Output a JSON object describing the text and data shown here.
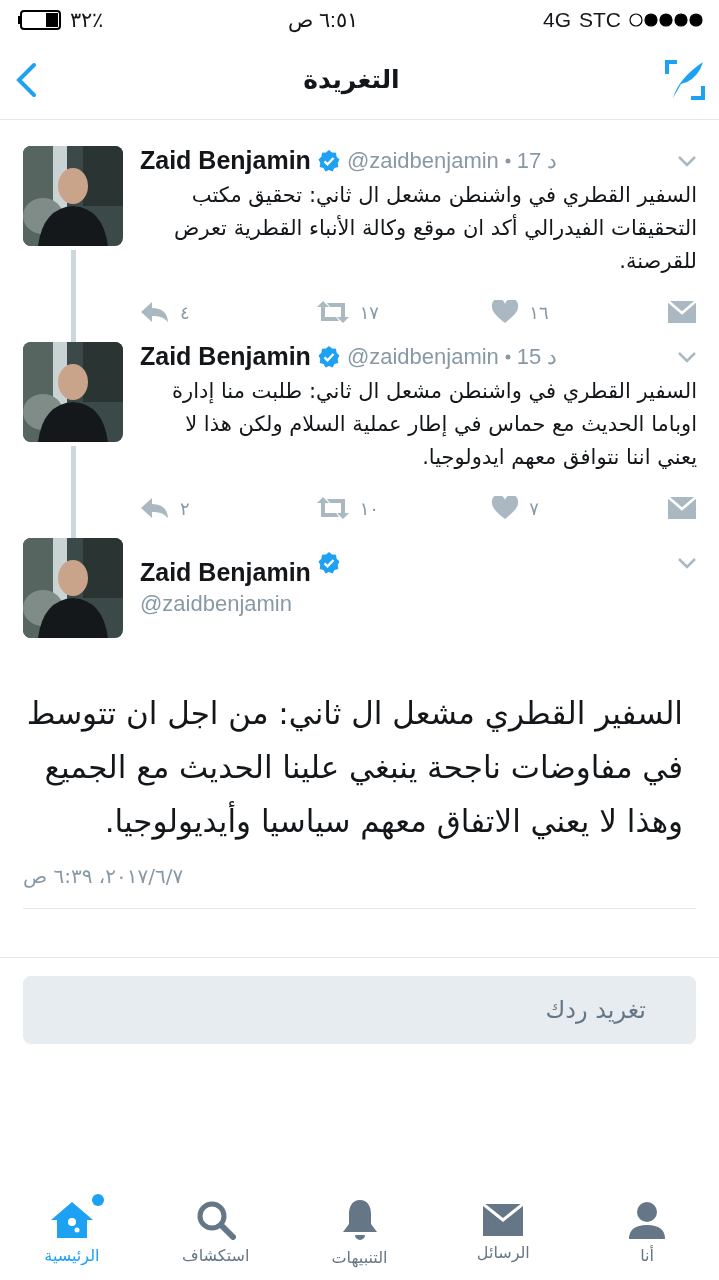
{
  "status_bar": {
    "carrier": "STC",
    "network": "4G",
    "time": "٦:٥١ ص",
    "battery": "٣٢٪"
  },
  "nav": {
    "title": "التغريدة"
  },
  "thread": [
    {
      "name": "Zaid Benjamin",
      "handle": "@zaidbenjamin",
      "time": "17 د",
      "verified": true,
      "text": "السفير القطري في واشنطن مشعل ال ثاني: تحقيق مكتب التحقيقات الفيدرالي أكد ان موقع وكالة الأنباء القطرية تعرض للقرصنة.",
      "replies": "٤",
      "retweets": "١٧",
      "likes": "١٦"
    },
    {
      "name": "Zaid Benjamin",
      "handle": "@zaidbenjamin",
      "time": "15 د",
      "verified": true,
      "text": "السفير القطري في واشنطن مشعل ال ثاني: طلبت منا إدارة اوباما الحديث مع حماس في إطار عملية السلام ولكن هذا لا يعني اننا نتوافق معهم ايدولوجيا.",
      "replies": "٢",
      "retweets": "١٠",
      "likes": "٧"
    }
  ],
  "main_tweet": {
    "name": "Zaid Benjamin",
    "handle": "@zaidbenjamin",
    "verified": true,
    "text": "السفير القطري مشعل ال ثاني: من اجل ان تتوسط في مفاوضات ناجحة ينبغي علينا الحديث مع الجميع وهذا لا يعني الاتفاق معهم سياسيا وأيديولوجيا.",
    "timestamp": "٢٠١٧/٦/٧، ٦:٣٩ ص"
  },
  "reply_box": {
    "placeholder": "تغريد ردك"
  },
  "tab_bar": [
    {
      "kind": "me",
      "label": "أنا",
      "selected": false,
      "badge": false
    },
    {
      "kind": "messages",
      "label": "الرسائل",
      "selected": false,
      "badge": false
    },
    {
      "kind": "notifications",
      "label": "التنبيهات",
      "selected": false,
      "badge": false
    },
    {
      "kind": "explore",
      "label": "استكشاف",
      "selected": false,
      "badge": false
    },
    {
      "kind": "home",
      "label": "الرئيسية",
      "selected": true,
      "badge": true
    }
  ]
}
